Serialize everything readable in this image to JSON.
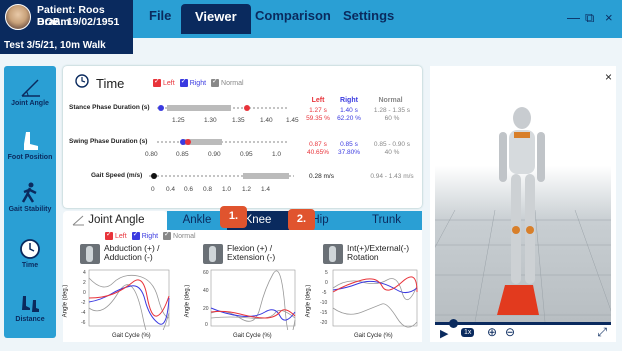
{
  "patient": {
    "name": "Patient: Roos Braam",
    "dob": "DOB: 19/02/1951",
    "test": "Test 3/5/21, 10m Walk"
  },
  "menu": {
    "file": "File",
    "viewer": "Viewer",
    "comparison": "Comparison",
    "settings": "Settings"
  },
  "window_controls": {
    "minimize": "—",
    "restore": "⧉",
    "close": "×"
  },
  "sidebar": {
    "items": [
      {
        "label": "Joint Angle"
      },
      {
        "label": "Foot Position"
      },
      {
        "label": "Gait Stability"
      },
      {
        "label": "Time"
      },
      {
        "label": "Distance"
      }
    ]
  },
  "time_panel": {
    "title": "Time",
    "legend": {
      "left": "Left",
      "right": "Right",
      "normal": "Normal"
    },
    "columns": {
      "left": "Left",
      "right": "Right",
      "normal": "Normal"
    },
    "rows": [
      {
        "label": "Stance Phase Duration (s)",
        "ticks": [
          "1.25",
          "1.30",
          "1.35",
          "1.40",
          "1.45"
        ],
        "left": [
          "1.27 s",
          "59.35 %"
        ],
        "right": [
          "1.40 s",
          "62.20 %"
        ],
        "normal": [
          "1.28 - 1.35 s",
          "60 %"
        ]
      },
      {
        "label": "Swing Phase Duration (s)",
        "ticks": [
          "0.80",
          "0.85",
          "0.90",
          "0.95",
          "1.0"
        ],
        "left": [
          "0.87 s",
          "40.65%"
        ],
        "right": [
          "0.85 s",
          "37.80%"
        ],
        "normal": [
          "0.85 - 0.90 s",
          "40 %"
        ]
      },
      {
        "label": "Gait Speed (m/s)",
        "ticks": [
          "0",
          "0.4",
          "0.6",
          "0.8",
          "1.0",
          "1.2",
          "1.4"
        ],
        "value": "0.28 m/s",
        "normal": "0.94 - 1.43 m/s"
      }
    ]
  },
  "tabs": {
    "joint_angle": "Joint Angle",
    "ankle": "Ankle",
    "knee": "Knee",
    "hip": "Hip",
    "trunk": "Trunk",
    "badge1": "1.",
    "badge2": "2."
  },
  "graphs": {
    "legend": {
      "left": "Left",
      "right": "Right",
      "normal": "Normal"
    },
    "ylabel": "Angle (deg.)",
    "xlabel": "Gait Cycle (%)",
    "xticks": [
      "0",
      "20",
      "40",
      "60",
      "80",
      "100"
    ],
    "abduction": {
      "title1": "Abduction (+) /",
      "title2": "Adduction (-)",
      "yticks": [
        "4",
        "2",
        "0",
        "-2",
        "-4",
        "-6"
      ]
    },
    "flexion": {
      "title1": "Flexion (+) /",
      "title2": "Extension (-)",
      "yticks": [
        "60",
        "40",
        "20",
        "0"
      ]
    },
    "rotation": {
      "title1": "Int(+)/External(-)",
      "title2": "Rotation",
      "yticks": [
        "5",
        "0",
        "-5",
        "-10",
        "-15",
        "-20"
      ]
    }
  },
  "viewer": {
    "close": "×",
    "speed": "1x",
    "zoom_in": "⊕",
    "zoom_out": "⊖",
    "fullscreen": "⤢",
    "progress": 0.1
  },
  "colors": {
    "accent": "#2a9fd4",
    "navy": "#0a2a5e",
    "left": "#e8333a",
    "right": "#3a3ae0",
    "normal": "#888888",
    "badge": "#e0542e"
  }
}
